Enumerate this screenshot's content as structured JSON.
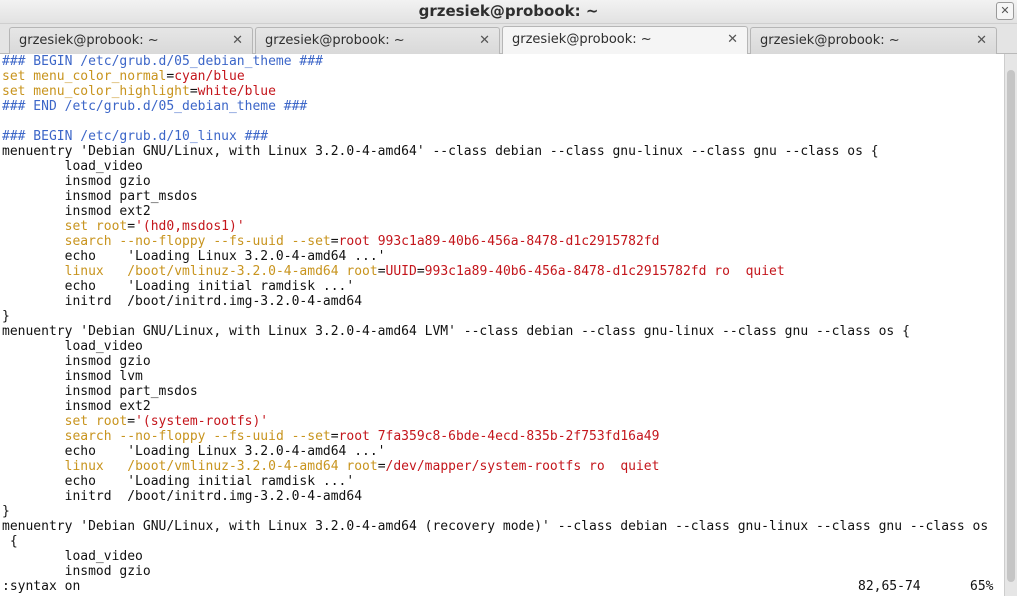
{
  "window": {
    "title": "grzesiek@probook: ~",
    "close_glyph": "✕"
  },
  "tabs": [
    {
      "label": "grzesiek@probook: ~",
      "active": false,
      "close_glyph": "✕"
    },
    {
      "label": "grzesiek@probook: ~",
      "active": false,
      "close_glyph": "✕"
    },
    {
      "label": "grzesiek@probook: ~",
      "active": true,
      "close_glyph": "✕"
    },
    {
      "label": "grzesiek@probook: ~",
      "active": false,
      "close_glyph": "✕"
    }
  ],
  "colors": {
    "comment": "#3c66c8",
    "keyword": "#c8941e",
    "string": "#c4161c",
    "text": "#111111"
  },
  "lines": [
    [
      [
        "cm",
        "### BEGIN /etc/grub.d/05_debian_theme ###"
      ]
    ],
    [
      [
        "kw",
        "set menu_color_normal"
      ],
      [
        "n",
        "="
      ],
      [
        "str",
        "cyan/blue"
      ]
    ],
    [
      [
        "kw",
        "set menu_color_highlight"
      ],
      [
        "n",
        "="
      ],
      [
        "str",
        "white/blue"
      ]
    ],
    [
      [
        "cm",
        "### END /etc/grub.d/05_debian_theme ###"
      ]
    ],
    [],
    [
      [
        "cm",
        "### BEGIN /etc/grub.d/10_linux ###"
      ]
    ],
    [
      [
        "n",
        "menuentry 'Debian GNU/Linux, with Linux 3.2.0-4-amd64' --class debian --class gnu-linux --class gnu --class os {"
      ]
    ],
    [
      [
        "n",
        "        load_video"
      ]
    ],
    [
      [
        "n",
        "        insmod gzio"
      ]
    ],
    [
      [
        "n",
        "        insmod part_msdos"
      ]
    ],
    [
      [
        "n",
        "        insmod ext2"
      ]
    ],
    [
      [
        "n",
        "        "
      ],
      [
        "kw",
        "set root"
      ],
      [
        "n",
        "="
      ],
      [
        "str",
        "'(hd0,msdos1)'"
      ]
    ],
    [
      [
        "n",
        "        "
      ],
      [
        "kw",
        "search --no-floppy --fs-uuid --set"
      ],
      [
        "n",
        "="
      ],
      [
        "str",
        "root 993c1a89-40b6-456a-8478-d1c2915782fd"
      ]
    ],
    [
      [
        "n",
        "        echo    'Loading Linux 3.2.0-4-amd64 ...'"
      ]
    ],
    [
      [
        "n",
        "        "
      ],
      [
        "kw",
        "linux   /boot/vmlinuz-3.2.0-4-amd64 root"
      ],
      [
        "n",
        "="
      ],
      [
        "str",
        "UUID"
      ],
      [
        "n",
        "="
      ],
      [
        "str",
        "993c1a89-40b6-456a-8478-d1c2915782fd ro  quiet"
      ]
    ],
    [
      [
        "n",
        "        echo    'Loading initial ramdisk ...'"
      ]
    ],
    [
      [
        "n",
        "        initrd  /boot/initrd.img-3.2.0-4-amd64"
      ]
    ],
    [
      [
        "n",
        "}"
      ]
    ],
    [
      [
        "n",
        "menuentry 'Debian GNU/Linux, with Linux 3.2.0-4-amd64 LVM' --class debian --class gnu-linux --class gnu --class os {"
      ]
    ],
    [
      [
        "n",
        "        load_video"
      ]
    ],
    [
      [
        "n",
        "        insmod gzio"
      ]
    ],
    [
      [
        "n",
        "        insmod lvm"
      ]
    ],
    [
      [
        "n",
        "        insmod part_msdos"
      ]
    ],
    [
      [
        "n",
        "        insmod ext2"
      ]
    ],
    [
      [
        "n",
        "        "
      ],
      [
        "kw",
        "set root"
      ],
      [
        "n",
        "="
      ],
      [
        "str",
        "'(system-rootfs)'"
      ]
    ],
    [
      [
        "n",
        "        "
      ],
      [
        "kw",
        "search --no-floppy --fs-uuid --set"
      ],
      [
        "n",
        "="
      ],
      [
        "str",
        "root 7fa359c8-6bde-4ecd-835b-2f753fd16a49"
      ]
    ],
    [
      [
        "n",
        "        echo    'Loading Linux 3.2.0-4-amd64 ...'"
      ]
    ],
    [
      [
        "n",
        "        "
      ],
      [
        "kw",
        "linux   /boot/vmlinuz-3.2.0-4-amd64 root"
      ],
      [
        "n",
        "="
      ],
      [
        "str",
        "/dev/mapper/system-rootfs ro  quiet"
      ]
    ],
    [
      [
        "n",
        "        echo    'Loading initial ramdisk ...'"
      ]
    ],
    [
      [
        "n",
        "        initrd  /boot/initrd.img-3.2.0-4-amd64"
      ]
    ],
    [
      [
        "n",
        "}"
      ]
    ],
    [
      [
        "n",
        "menuentry 'Debian GNU/Linux, with Linux 3.2.0-4-amd64 (recovery mode)' --class debian --class gnu-linux --class gnu --class o"
      ],
      [
        "n",
        "s"
      ]
    ],
    [
      [
        "n",
        " {"
      ]
    ],
    [
      [
        "n",
        "        load_video"
      ]
    ],
    [
      [
        "n",
        "        insmod gzio"
      ]
    ]
  ],
  "status": {
    "command": ":syntax on",
    "position": "82,65-74",
    "percent": "65%"
  }
}
